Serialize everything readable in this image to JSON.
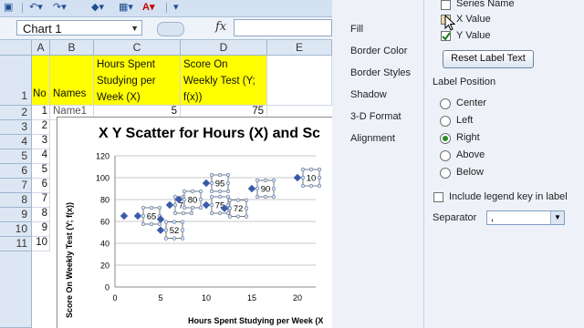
{
  "excel": {
    "name_box": "Chart 1",
    "fx_label": "fx",
    "columns": [
      "A",
      "B",
      "C",
      "D",
      "E"
    ],
    "rows": [
      "1",
      "2",
      "3",
      "4",
      "5",
      "6",
      "7",
      "8",
      "9",
      "10",
      "11"
    ],
    "headers": {
      "no": "No",
      "names": "Names",
      "x": "Hours Spent Studying per Week (X)",
      "y": "Score On Weekly Test (Y; f(x))"
    },
    "row2": {
      "no": "1",
      "name": "Name1",
      "x": "5",
      "y": "75"
    },
    "row_numbers": [
      "2",
      "3",
      "4",
      "5",
      "6",
      "7",
      "8",
      "9",
      "10"
    ]
  },
  "chart": {
    "title": "X Y Scatter for Hours (X) and Sc",
    "ylabel": "Score On Weekly Test (Y; f(x))",
    "xlabel": "Hours Spent Studying per Week (X",
    "x_ticks": [
      "0",
      "5",
      "10",
      "15",
      "20"
    ],
    "y_ticks": [
      "0",
      "20",
      "40",
      "60",
      "80",
      "100",
      "120"
    ]
  },
  "chart_data": {
    "type": "scatter",
    "title": "X Y Scatter for Hours (X) and Sc",
    "xlabel": "Hours Spent Studying per Week (X",
    "ylabel": "Score On Weekly Test (Y; f(x))",
    "xlim": [
      0,
      22
    ],
    "ylim": [
      0,
      120
    ],
    "points": [
      {
        "x": 1,
        "y": 65,
        "label": ""
      },
      {
        "x": 2.5,
        "y": 65,
        "label": "65"
      },
      {
        "x": 5,
        "y": 52,
        "label": "52"
      },
      {
        "x": 5,
        "y": 62,
        "label": ""
      },
      {
        "x": 6,
        "y": 75,
        "label": "75"
      },
      {
        "x": 7,
        "y": 80,
        "label": "80"
      },
      {
        "x": 10,
        "y": 75,
        "label": "75"
      },
      {
        "x": 10,
        "y": 95,
        "label": "95"
      },
      {
        "x": 12,
        "y": 72,
        "label": "72"
      },
      {
        "x": 15,
        "y": 90,
        "label": "90"
      },
      {
        "x": 20,
        "y": 100,
        "label": "10"
      }
    ],
    "grid": true
  },
  "dialog": {
    "nav": [
      "Fill",
      "Border Color",
      "Border Styles",
      "Shadow",
      "3-D Format",
      "Alignment"
    ],
    "label_contains": [
      {
        "label": "Series Name",
        "checked": false
      },
      {
        "label": "X Value",
        "checked": false
      },
      {
        "label": "Y Value",
        "checked": true
      }
    ],
    "reset_button": "Reset Label Text",
    "label_position_title": "Label Position",
    "positions": [
      {
        "label": "Center",
        "selected": false
      },
      {
        "label": "Left",
        "selected": false
      },
      {
        "label": "Right",
        "selected": true
      },
      {
        "label": "Above",
        "selected": false
      },
      {
        "label": "Below",
        "selected": false
      }
    ],
    "include_legend_key": "Include legend key in label",
    "separator_label": "Separator",
    "separator_value": ","
  }
}
